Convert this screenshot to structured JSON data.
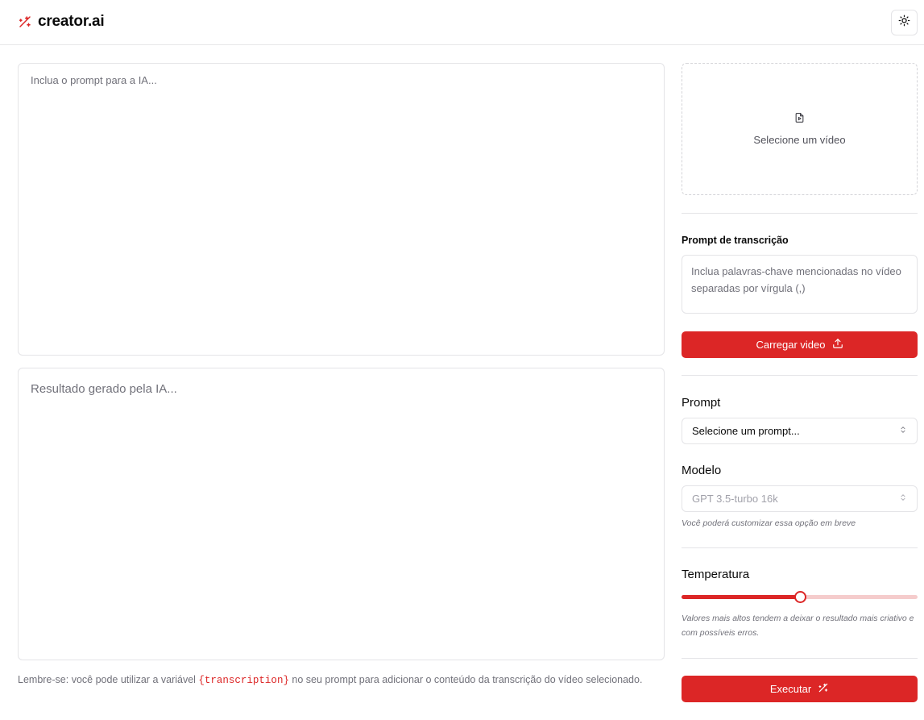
{
  "header": {
    "brand": "creator.ai",
    "logo_icon": "magic-wand-icon",
    "theme_toggle_icon": "sun-icon"
  },
  "main": {
    "prompt_placeholder": "Inclua o prompt para a IA...",
    "result_placeholder": "Resultado gerado pela IA...",
    "hint": {
      "before": "Lembre-se: você pode utilizar a variável ",
      "variable": "{transcription}",
      "after": " no seu prompt para adicionar o conteúdo da transcrição do vídeo selecionado."
    }
  },
  "sidebar": {
    "upload": {
      "icon": "file-video-icon",
      "label": "Selecione um vídeo"
    },
    "transcription": {
      "label": "Prompt de transcrição",
      "placeholder": "Inclua palavras-chave mencionadas no vídeo separadas por vírgula (,)",
      "button_label": "Carregar video",
      "button_icon": "upload-icon"
    },
    "prompt": {
      "label": "Prompt",
      "selected": "Selecione um prompt..."
    },
    "model": {
      "label": "Modelo",
      "selected": "GPT 3.5-turbo 16k",
      "note": "Você poderá customizar essa opção em breve"
    },
    "temperature": {
      "label": "Temperatura",
      "value": 0.5,
      "note": "Valores mais altos tendem a deixar o resultado mais criativo e com possíveis erros."
    },
    "execute": {
      "label": "Executar",
      "icon": "magic-wand-icon"
    }
  },
  "colors": {
    "accent": "#dc2626",
    "slider_track": "#f5cccc",
    "border": "#e4e4e7",
    "muted_text": "#71717a"
  }
}
